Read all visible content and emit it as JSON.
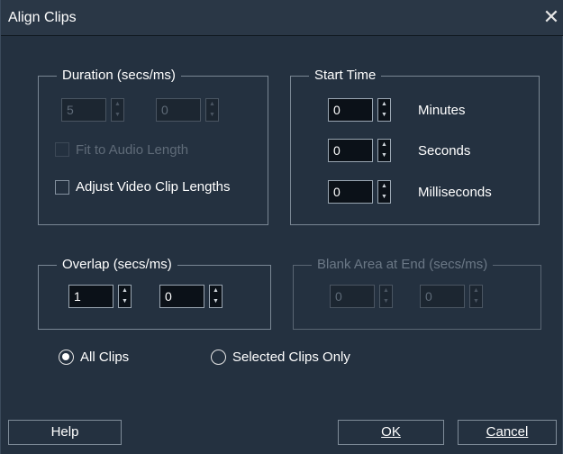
{
  "window": {
    "title": "Align Clips",
    "close_icon": "close-icon"
  },
  "duration": {
    "legend": "Duration (secs/ms)",
    "secs_value": "5",
    "ms_value": "0",
    "fit_audio_label": "Fit to Audio Length",
    "adjust_video_label": "Adjust Video Clip Lengths"
  },
  "start_time": {
    "legend": "Start Time",
    "minutes_value": "0",
    "minutes_label": "Minutes",
    "seconds_value": "0",
    "seconds_label": "Seconds",
    "milliseconds_value": "0",
    "milliseconds_label": "Milliseconds"
  },
  "overlap": {
    "legend": "Overlap (secs/ms)",
    "secs_value": "1",
    "ms_value": "0"
  },
  "blank_area": {
    "legend": "Blank Area at End (secs/ms)",
    "secs_value": "0",
    "ms_value": "0"
  },
  "scope": {
    "all_clips_label": "All Clips",
    "selected_clips_label": "Selected Clips Only",
    "selected": "All Clips"
  },
  "buttons": {
    "help": "Help",
    "ok": "OK",
    "cancel": "Cancel"
  },
  "icons": {
    "spin_up": "▲",
    "spin_down": "▼",
    "close": "✕"
  },
  "colors": {
    "background": "#243140",
    "border": "#7a8794",
    "disabled_text": "#5f6b78"
  }
}
